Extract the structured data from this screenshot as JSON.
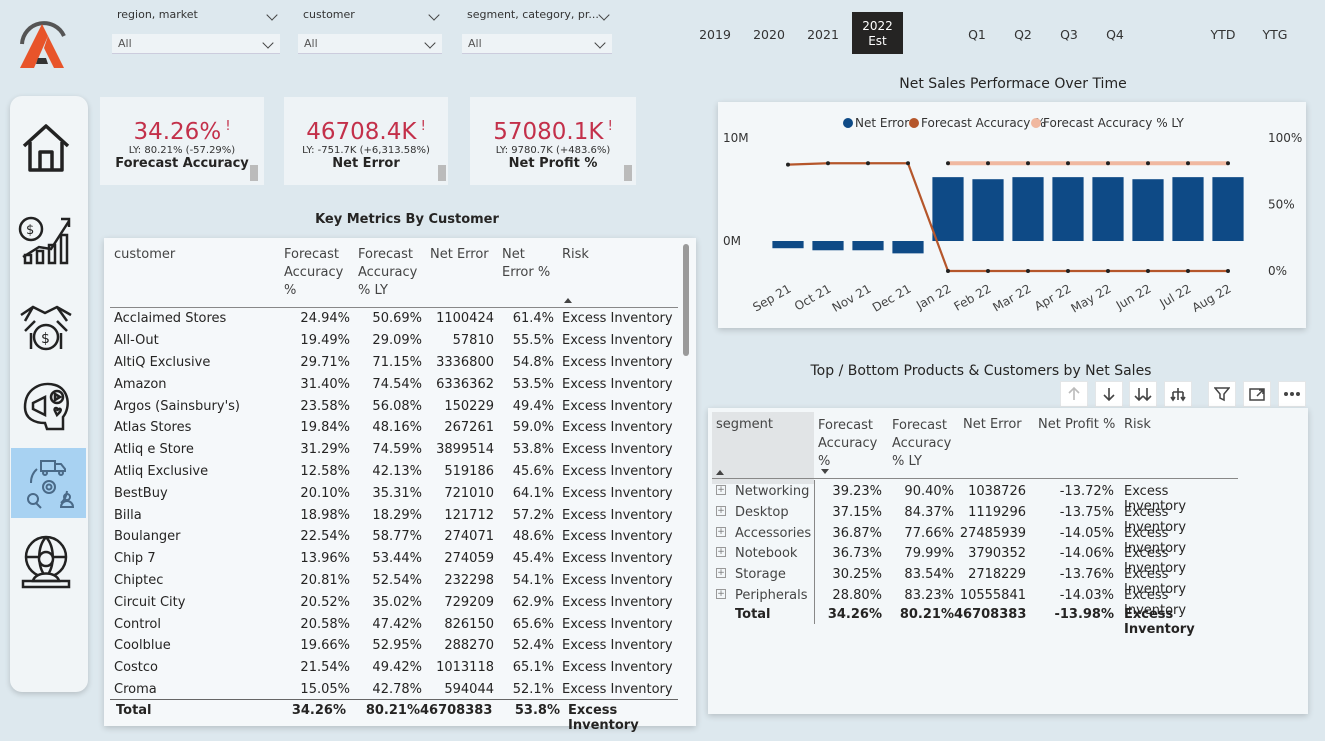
{
  "filters": [
    {
      "label": "region, market",
      "value": "All"
    },
    {
      "label": "customer",
      "value": "All"
    },
    {
      "label": "segment, category, pr...",
      "value": "All"
    }
  ],
  "years": [
    "2019",
    "2020",
    "2021"
  ],
  "selected_year": {
    "line1": "2022",
    "line2": "Est"
  },
  "quarters": [
    "Q1",
    "Q2",
    "Q3",
    "Q4"
  ],
  "periods": [
    "YTD",
    "YTG"
  ],
  "kpis": [
    {
      "value": "34.26%",
      "flag": "!",
      "ly": "LY: 80.21% (-57.29%)",
      "title": "Forecast Accuracy"
    },
    {
      "value": "46708.4K",
      "flag": "!",
      "ly": "LY: -751.7K (+6,313.58%)",
      "title": "Net Error"
    },
    {
      "value": "57080.1K",
      "flag": "!",
      "ly": "LY: 9780.7K (+483.6%)",
      "title": "Net Profit %"
    }
  ],
  "customer_table": {
    "title": "Key Metrics By Customer",
    "headers": [
      "customer",
      "Forecast Accuracy %",
      "Forecast Accuracy % LY",
      "Net Error",
      "Net Error %",
      "Risk"
    ],
    "rows": [
      [
        "Acclaimed Stores",
        "24.94%",
        "50.69%",
        "1100424",
        "61.4%",
        "Excess Inventory"
      ],
      [
        "All-Out",
        "19.49%",
        "29.09%",
        "57810",
        "55.5%",
        "Excess Inventory"
      ],
      [
        "AltiQ Exclusive",
        "29.71%",
        "71.15%",
        "3336800",
        "54.8%",
        "Excess Inventory"
      ],
      [
        "Amazon",
        "31.40%",
        "74.54%",
        "6336362",
        "53.5%",
        "Excess Inventory"
      ],
      [
        "Argos (Sainsbury's)",
        "23.58%",
        "56.08%",
        "150229",
        "49.4%",
        "Excess Inventory"
      ],
      [
        "Atlas Stores",
        "19.84%",
        "48.16%",
        "267261",
        "59.0%",
        "Excess Inventory"
      ],
      [
        "Atliq e Store",
        "31.29%",
        "74.59%",
        "3899514",
        "53.8%",
        "Excess Inventory"
      ],
      [
        "Atliq Exclusive",
        "12.58%",
        "42.13%",
        "519186",
        "45.6%",
        "Excess Inventory"
      ],
      [
        "BestBuy",
        "20.10%",
        "35.31%",
        "721010",
        "64.1%",
        "Excess Inventory"
      ],
      [
        "Billa",
        "18.98%",
        "18.29%",
        "121712",
        "57.2%",
        "Excess Inventory"
      ],
      [
        "Boulanger",
        "22.54%",
        "58.77%",
        "274071",
        "48.6%",
        "Excess Inventory"
      ],
      [
        "Chip 7",
        "13.96%",
        "53.44%",
        "274059",
        "45.4%",
        "Excess Inventory"
      ],
      [
        "Chiptec",
        "20.81%",
        "52.54%",
        "232298",
        "54.1%",
        "Excess Inventory"
      ],
      [
        "Circuit City",
        "20.52%",
        "35.02%",
        "729209",
        "62.9%",
        "Excess Inventory"
      ],
      [
        "Control",
        "20.58%",
        "47.42%",
        "826150",
        "65.6%",
        "Excess Inventory"
      ],
      [
        "Coolblue",
        "19.66%",
        "52.95%",
        "288270",
        "52.4%",
        "Excess Inventory"
      ],
      [
        "Costco",
        "21.54%",
        "49.42%",
        "1013118",
        "65.1%",
        "Excess Inventory"
      ],
      [
        "Croma",
        "15.05%",
        "42.78%",
        "594044",
        "52.1%",
        "Excess Inventory"
      ]
    ],
    "total": [
      "Total",
      "34.26%",
      "80.21%",
      "46708383",
      "53.8%",
      "Excess Inventory"
    ]
  },
  "chart_data": {
    "type": "bar",
    "title": "Net Sales Performace Over Time",
    "categories": [
      "Sep 21",
      "Oct 21",
      "Nov 21",
      "Dec 21",
      "Jan 22",
      "Feb 22",
      "Mar 22",
      "Apr 22",
      "May 22",
      "Jun 22",
      "Jul 22",
      "Aug 22"
    ],
    "series": [
      {
        "name": "Net Error",
        "kind": "bar",
        "axis": "left",
        "color": "#0e4a86",
        "values": [
          -0.7,
          -0.9,
          -0.9,
          -1.2,
          6.2,
          6.0,
          6.2,
          6.2,
          6.2,
          6.0,
          6.2,
          6.2
        ]
      },
      {
        "name": "Forecast Accuracy %",
        "kind": "line",
        "axis": "right",
        "color": "#b5562b",
        "values": [
          80,
          81,
          81,
          81,
          0,
          0,
          0,
          0,
          0,
          0,
          0,
          0
        ]
      },
      {
        "name": "Forecast Accuracy % LY",
        "kind": "line",
        "axis": "right",
        "color": "#f0b8a0",
        "values": [
          null,
          null,
          null,
          null,
          81,
          81,
          81,
          81,
          81,
          81,
          81,
          81
        ]
      }
    ],
    "left_ticks": [
      "10M",
      "0M"
    ],
    "right_ticks": [
      "100%",
      "50%",
      "0%"
    ],
    "left_range": [
      -3.3,
      10
    ],
    "right_range": [
      -3,
      100
    ],
    "legend_position": "top"
  },
  "product_table": {
    "title": "Top / Bottom Products & Customers by Net Sales",
    "headers": [
      "segment",
      "Forecast Accuracy %",
      "Forecast Accuracy % LY",
      "Net Error",
      "Net Profit %",
      "Risk"
    ],
    "rows": [
      [
        "Networking",
        "39.23%",
        "90.40%",
        "1038726",
        "-13.72%",
        "Excess Inventory"
      ],
      [
        "Desktop",
        "37.15%",
        "84.37%",
        "1119296",
        "-13.75%",
        "Excess Inventory"
      ],
      [
        "Accessories",
        "36.87%",
        "77.66%",
        "27485939",
        "-14.05%",
        "Excess Inventory"
      ],
      [
        "Notebook",
        "36.73%",
        "79.99%",
        "3790352",
        "-14.06%",
        "Excess Inventory"
      ],
      [
        "Storage",
        "30.25%",
        "83.54%",
        "2718229",
        "-13.76%",
        "Excess Inventory"
      ],
      [
        "Peripherals",
        "28.80%",
        "83.23%",
        "10555841",
        "-14.03%",
        "Excess Inventory"
      ]
    ],
    "total": [
      "Total",
      "34.26%",
      "80.21%",
      "46708383",
      "-13.98%",
      "Excess Inventory"
    ]
  },
  "colors": {
    "accent": "#c3304a",
    "bar": "#0e4a86",
    "nav_active": "#a8d2f2",
    "logo_orange": "#e8542a"
  }
}
